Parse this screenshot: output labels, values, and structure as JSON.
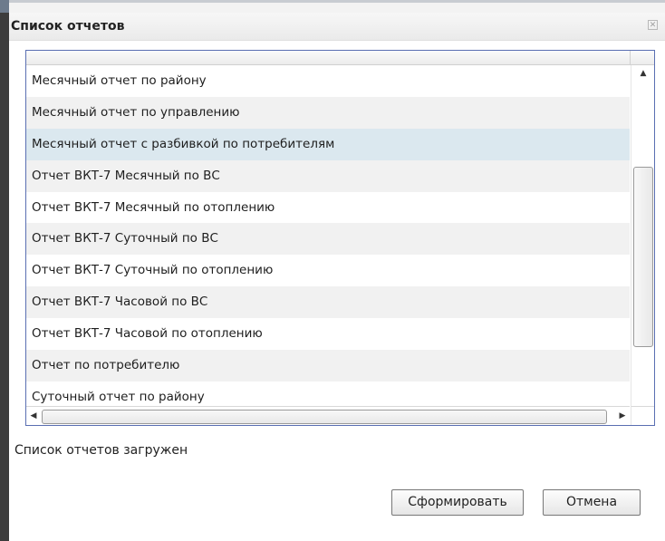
{
  "dialog": {
    "title": "Список отчетов",
    "close_icon": "close-icon"
  },
  "reports": [
    "Месячный отчет по району",
    "Месячный отчет по управлению",
    "Месячный отчет с разбивкой по потребителям",
    "Отчет ВКТ-7 Месячный по ВС",
    "Отчет ВКТ-7 Месячный по отоплению",
    "Отчет ВКТ-7 Суточный по ВС",
    "Отчет ВКТ-7 Суточный по отоплению",
    "Отчет ВКТ-7 Часовой по ВС",
    "Отчет ВКТ-7 Часовой по отоплению",
    "Отчет по потребителю",
    "Суточный отчет по району"
  ],
  "selected_index": 2,
  "scrollbars": {
    "up_arrow": "▲",
    "down_arrow": "▼",
    "left_arrow": "◀",
    "right_arrow": "▶"
  },
  "status": "Список отчетов загружен",
  "buttons": {
    "generate": "Сформировать",
    "cancel": "Отмена"
  },
  "colors": {
    "selection": "#dbe8ef",
    "alt_row": "#f1f1f1",
    "frame_border": "#5a6fb2"
  }
}
